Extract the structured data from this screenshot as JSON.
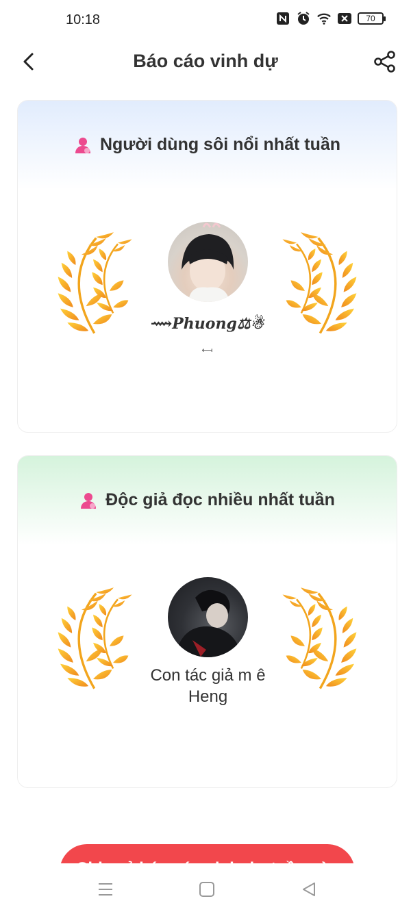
{
  "status_bar": {
    "time": "10:18",
    "battery": "70",
    "icons": [
      "nfc-icon",
      "alarm-icon",
      "wifi-icon",
      "signal-off-icon",
      "battery-icon"
    ]
  },
  "header": {
    "title": "Báo cáo vinh dự",
    "back_icon": "chevron-left-icon",
    "share_icon": "share-icon"
  },
  "cards": [
    {
      "title": "Người dùng sôi nổi nhất tuần",
      "icon": "user-icon",
      "user_name": "⟿𝑷𝒉𝒖𝒐𝒏𝒈⚖☃",
      "user_sub": "⟻",
      "accent": "#e1ecfd"
    },
    {
      "title": "Độc giả đọc nhiều nhất tuần",
      "icon": "user-icon",
      "user_name": "Con tác giả m ê Heng",
      "accent": "#d5f3dc"
    }
  ],
  "bottom_button": {
    "label": "Chia sẻ báo cáo vinh dự tuần này"
  },
  "colors": {
    "primary": "#f2474c",
    "icon_pink": "#ec4a8f",
    "laurel_gold": "#f6b21a",
    "laurel_orange": "#f08a1c"
  },
  "system_nav": {
    "icons": [
      "menu-icon",
      "home-icon",
      "back-triangle-icon"
    ]
  }
}
